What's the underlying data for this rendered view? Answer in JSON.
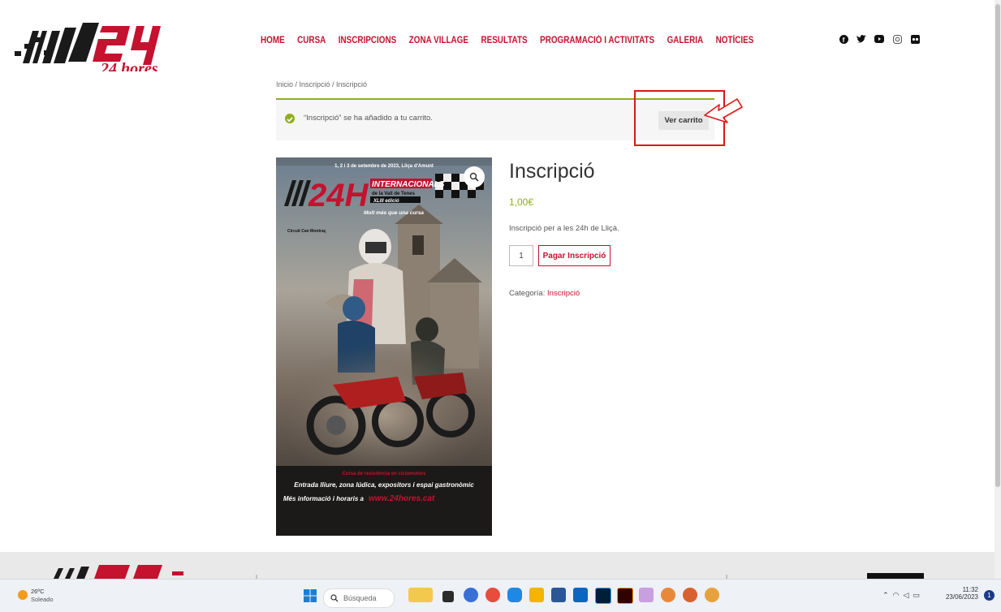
{
  "site": {
    "logo_text": "24 hores"
  },
  "nav": {
    "items": [
      "HOME",
      "CURSA",
      "INSCRIPCIONS",
      "ZONA VILLAGE",
      "RESULTATS",
      "PROGRAMACIÓ I ACTIVITATS",
      "GALERIA",
      "NOTÍCIES"
    ]
  },
  "social": [
    "facebook-icon",
    "twitter-icon",
    "youtube-icon",
    "instagram-icon",
    "flickr-icon"
  ],
  "breadcrumb": "Inicio / Inscripció / Inscripció",
  "notice": {
    "message": "“Inscripció” se ha añadido a tu carrito.",
    "button": "Ver carrito"
  },
  "poster": {
    "date_line": "1, 2 i 3 de setembre de 2023, Lliça d'Amunt",
    "big": "24H",
    "internacionals": "INTERNACIONALS",
    "vall": "de la Vall de Tenes",
    "edicio": "XLIII edició",
    "tagline": "Molt més que una cursa",
    "circuit": "Circuit Can Montraç",
    "footer_red": "Cursa de resistència en ciclomotors",
    "footer_1": "Entrada lliure, zona lúdica, expositors i espai gastronòmic",
    "footer_2a": "Més informació i horaris a",
    "footer_2b": "www.24hores.cat"
  },
  "product": {
    "title": "Inscripció",
    "price": "1,00€",
    "description": "Inscripció per a les 24h de Lliçà.",
    "quantity": "1",
    "add_button": "Pagar Inscripció",
    "category_label": "Categoría:",
    "category_value": "Inscripció"
  },
  "taskbar": {
    "weather_temp": "26ºC",
    "weather_text": "Soleado",
    "search_placeholder": "Búsqueda",
    "time": "11:32",
    "date": "23/06/2023",
    "notifications": "1"
  },
  "colors": {
    "accent": "#c4122f",
    "success": "#8fae1b",
    "highlight": "#e01616"
  }
}
